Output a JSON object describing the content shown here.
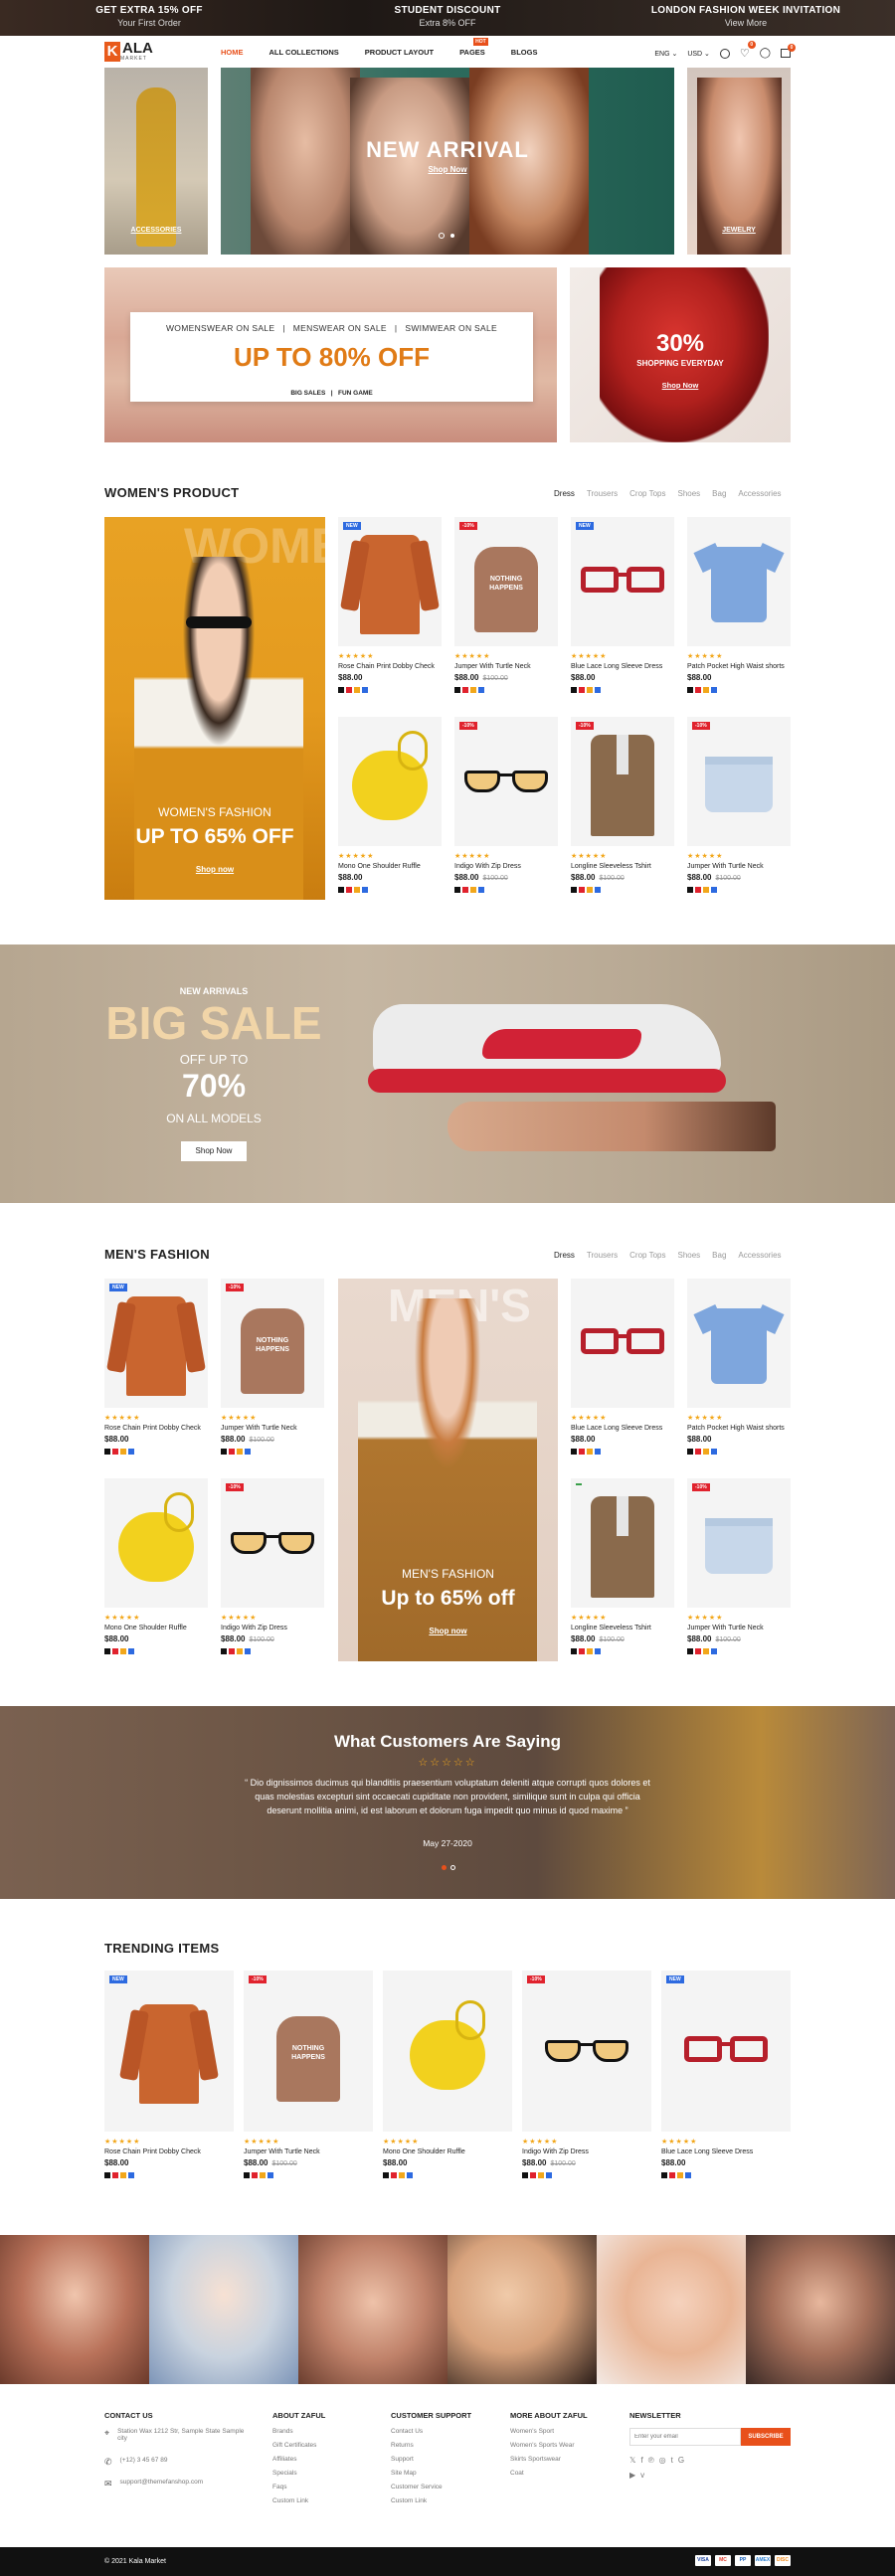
{
  "topbar": [
    {
      "title": "GET EXTRA 15% OFF",
      "sub": "Your First Order"
    },
    {
      "title": "STUDENT DISCOUNT",
      "sub": "Extra 8% OFF"
    },
    {
      "title": "LONDON FASHION WEEK INVITATION",
      "sub": "View More"
    }
  ],
  "logo": {
    "letter": "K",
    "name": "ALA",
    "sub": "MARKET"
  },
  "nav": {
    "home": "HOME",
    "collections": "ALL COLLECTIONS",
    "layout": "PRODUCT LAYOUT",
    "pages": "PAGES",
    "hot": "HOT",
    "blogs": "BLOGS",
    "lang": "ENG",
    "currency": "USD",
    "wish_count": "0",
    "cart_count": "0"
  },
  "hero": {
    "left_label": "ACCESSORIES",
    "title": "NEW ARRIVAL",
    "cta": "Shop Now",
    "right_label": "JEWELRY"
  },
  "sale_banner": {
    "cats": [
      "WOMENSWEAR ON SALE",
      "MENSWEAR ON SALE",
      "SWIMWEAR ON SALE"
    ],
    "headline": "UP TO 80% OFF",
    "links": [
      "BIG SALES",
      "FUN GAME"
    ]
  },
  "promo30": {
    "pct": "30%",
    "sub": "SHOPPING EVERYDAY",
    "cta": "Shop Now"
  },
  "women": {
    "title": "WOMEN'S PRODUCT",
    "tabs": [
      "Dress",
      "Trousers",
      "Crop Tops",
      "Shoes",
      "Bag",
      "Accessories"
    ],
    "banner_sub": "WOMEN'S FASHION",
    "banner_head": "UP TO 65% OFF",
    "banner_cta": "Shop now",
    "watermark": "WOMEN"
  },
  "bigsale": {
    "kicker": "NEW ARRIVALS",
    "title": "BIG SALE",
    "offup": "OFF UP TO",
    "pct": "70%",
    "models": "ON ALL MODELS",
    "cta": "Shop Now"
  },
  "men": {
    "title": "MEN'S FASHION",
    "tabs": [
      "Dress",
      "Trousers",
      "Crop Tops",
      "Shoes",
      "Bag",
      "Accessories"
    ],
    "banner_sub": "MEN'S FASHION",
    "banner_head": "Up to 65% off",
    "banner_cta": "Shop now",
    "watermark": "MEN'S"
  },
  "testimonial": {
    "title": "What Customers Are Saying",
    "stars": "☆☆☆☆☆",
    "quote": "“ Dio dignissimos ducimus qui blanditiis praesentium voluptatum deleniti atque corrupti quos dolores et quas molestias excepturi sint occaecati cupiditate non provident, similique sunt in culpa qui officia deserunt mollitia animi, id est laborum et dolorum fuga impedit quo minus id quod maxime ”",
    "date": "May 27-2020"
  },
  "trending": {
    "title": "TRENDING ITEMS"
  },
  "products": {
    "shirt": {
      "name": "Rose Chain Print Dobby Check",
      "price": "$88.00",
      "old": ""
    },
    "hoodie": {
      "name": "Jumper With Turtle Neck",
      "price": "$88.00",
      "old": "$100.00"
    },
    "glasses_red": {
      "name": "Blue Lace Long Sleeve Dress",
      "price": "$88.00",
      "old": ""
    },
    "tshirt": {
      "name": "Patch Pocket High Waist shorts",
      "price": "$88.00",
      "old": ""
    },
    "bag": {
      "name": "Mono One Shoulder Ruffle",
      "price": "$88.00",
      "old": ""
    },
    "sunglasses": {
      "name": "Indigo With Zip Dress",
      "price": "$88.00",
      "old": "$100.00"
    },
    "blazer": {
      "name": "Longline Sleeveless Tshirt",
      "price": "$88.00",
      "old": "$100.00"
    },
    "shorts": {
      "name": "Jumper With Turtle Neck",
      "price": "$88.00",
      "old": "$100.00"
    },
    "glasses_red_t": {
      "name": "Blue Lace Long Sleeve Dress",
      "price": "$88.00",
      "old": ""
    }
  },
  "tags": {
    "new": "NEW",
    "sale": "-10%",
    "hot": "HOT"
  },
  "hoodie_text": "NOTHING HAPPENS",
  "footer": {
    "contact": {
      "title": "CONTACT US",
      "address": "Station Wax 1212 Str, Sample State Sample city",
      "phone": "(+12) 3 45 67 89",
      "email": "support@themefanshop.com"
    },
    "about": {
      "title": "ABOUT ZAFUL",
      "links": [
        "Brands",
        "Gift Certificates",
        "Affiliates",
        "Specials",
        "Faqs",
        "Custom Link"
      ]
    },
    "support": {
      "title": "CUSTOMER SUPPORT",
      "links": [
        "Contact Us",
        "Returns",
        "Support",
        "Site Map",
        "Customer Service",
        "Custom Link"
      ]
    },
    "more": {
      "title": "MORE ABOUT ZAFUL",
      "links": [
        "Women's Sport",
        "Women's Sports Wear",
        "Skirts Sportswear",
        "Coat"
      ]
    },
    "newsletter": {
      "title": "NEWSLETTER",
      "placeholder": "Enter your email",
      "button": "SUBSCRIBE"
    },
    "copyright": "© 2021 Kala Market",
    "payments": [
      "VISA",
      "MC",
      "PP",
      "AMEX",
      "DISC"
    ]
  },
  "colors": {
    "accent": "#e8501b",
    "orange": "#e07b16",
    "gold": "#f1d5a8"
  }
}
